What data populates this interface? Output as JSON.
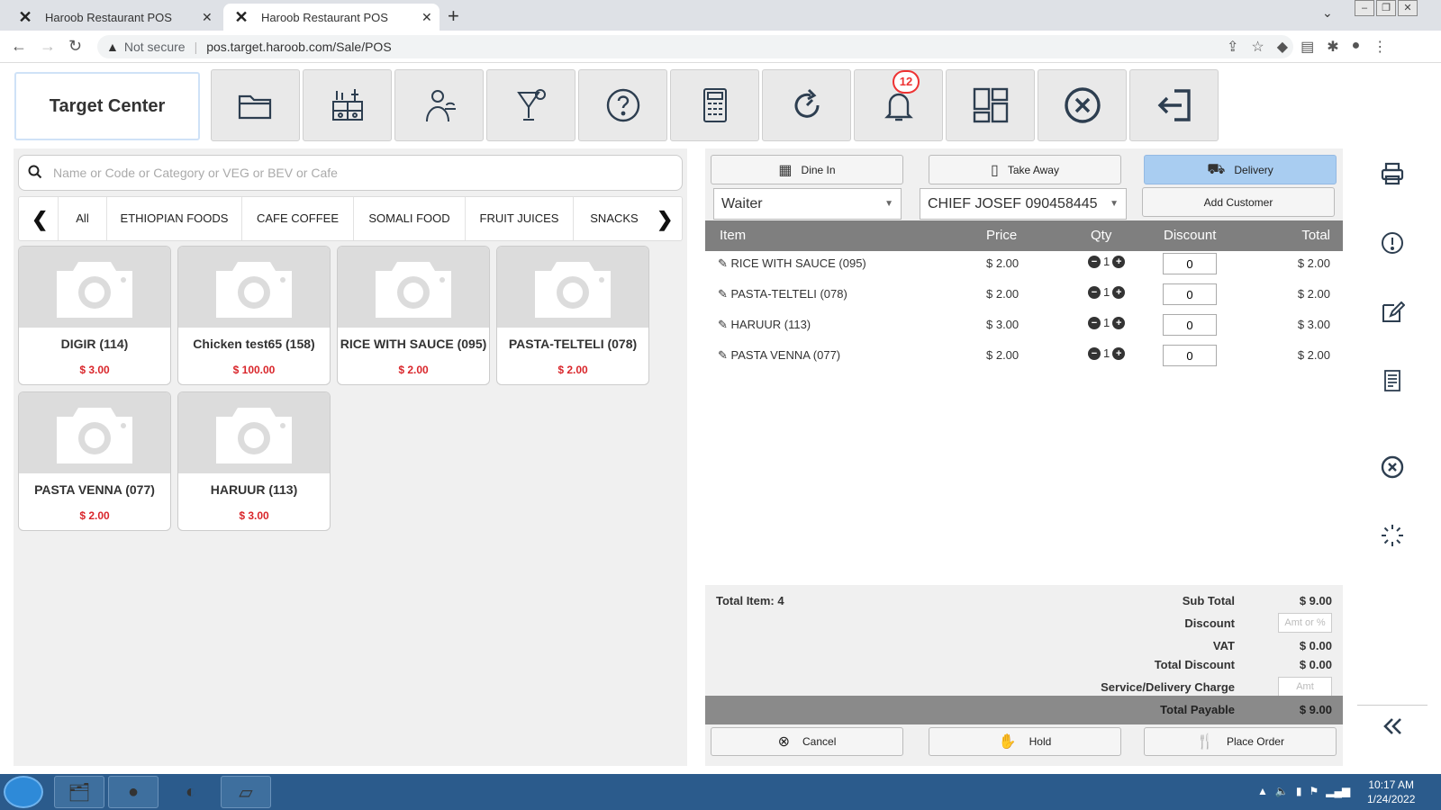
{
  "browser": {
    "tabs": [
      {
        "title": "Haroob Restaurant POS"
      },
      {
        "title": "Haroob Restaurant POS"
      }
    ],
    "security": "Not secure",
    "url": "pos.target.haroob.com/Sale/POS"
  },
  "toolbar": {
    "brand": "Target Center",
    "notification_count": "12"
  },
  "search": {
    "placeholder": "Name or Code or Category or VEG or BEV or Cafe"
  },
  "categories": [
    "All",
    "ETHIOPIAN FOODS",
    "CAFE COFFEE",
    "SOMALI FOOD",
    "FRUIT JUICES",
    "SNACKS"
  ],
  "products": [
    {
      "name": "DIGIR (114)",
      "price": "$ 3.00"
    },
    {
      "name": "Chicken test65 (158)",
      "price": "$ 100.00"
    },
    {
      "name": "RICE WITH SAUCE (095)",
      "price": "$ 2.00"
    },
    {
      "name": "PASTA-TELTELI (078)",
      "price": "$ 2.00"
    },
    {
      "name": "PASTA VENNA (077)",
      "price": "$ 2.00"
    },
    {
      "name": "HARUUR (113)",
      "price": "$ 3.00"
    }
  ],
  "order": {
    "types": [
      "Dine In",
      "Take Away",
      "Delivery"
    ],
    "waiter": "Waiter",
    "customer": "CHIEF JOSEF 090458445",
    "add_customer": "Add Customer",
    "headers": {
      "item": "Item",
      "price": "Price",
      "qty": "Qty",
      "discount": "Discount",
      "total": "Total"
    },
    "items": [
      {
        "name": "RICE WITH SAUCE (095)",
        "price": "$ 2.00",
        "qty": "1",
        "discount": "0",
        "total": "$ 2.00"
      },
      {
        "name": "PASTA-TELTELI (078)",
        "price": "$ 2.00",
        "qty": "1",
        "discount": "0",
        "total": "$ 2.00"
      },
      {
        "name": "HARUUR (113)",
        "price": "$ 3.00",
        "qty": "1",
        "discount": "0",
        "total": "$ 3.00"
      },
      {
        "name": "PASTA VENNA (077)",
        "price": "$ 2.00",
        "qty": "1",
        "discount": "0",
        "total": "$ 2.00"
      }
    ],
    "summary": {
      "total_item": "Total Item: 4",
      "sub_total_label": "Sub Total",
      "sub_total": "$ 9.00",
      "discount_label": "Discount",
      "discount_placeholder": "Amt or %",
      "vat_label": "VAT",
      "vat": "$ 0.00",
      "total_discount_label": "Total Discount",
      "total_discount": "$ 0.00",
      "service_label": "Service/Delivery Charge",
      "service_placeholder": "Amt",
      "payable_label": "Total Payable",
      "payable": "$ 9.00"
    },
    "actions": [
      "Cancel",
      "Hold",
      "Place Order"
    ]
  },
  "taskbar": {
    "time": "10:17 AM",
    "date": "1/24/2022"
  },
  "colors": {
    "accent": "#a9cdf1",
    "price_red": "#d9262b",
    "header_gray": "#7f7f7f"
  }
}
